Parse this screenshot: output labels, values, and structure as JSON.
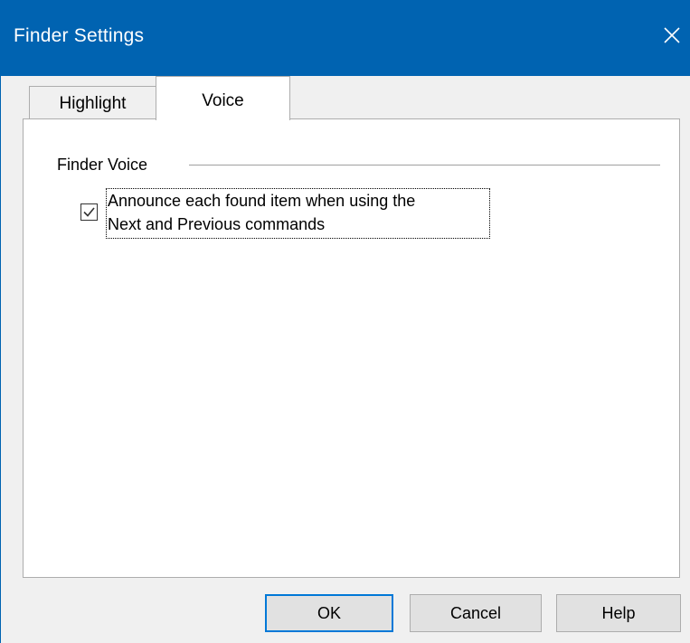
{
  "window": {
    "title": "Finder Settings"
  },
  "tabs": [
    {
      "label": "Highlight",
      "selected": false
    },
    {
      "label": "Voice",
      "selected": true
    }
  ],
  "voice_panel": {
    "group_label": "Finder Voice",
    "checkbox": {
      "checked": true,
      "label": "Announce each found item when using the\nNext and Previous commands"
    }
  },
  "buttons": {
    "ok": "OK",
    "cancel": "Cancel",
    "help": "Help"
  },
  "colors": {
    "titlebar": "#0063b1",
    "focus_border": "#0078d7"
  },
  "icons": {
    "close": "close-icon",
    "check": "checkmark-icon"
  }
}
